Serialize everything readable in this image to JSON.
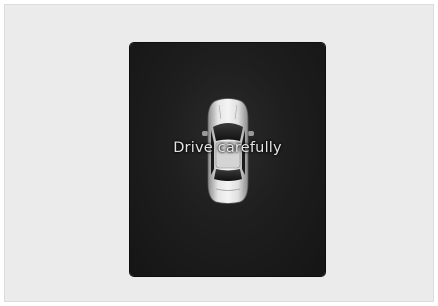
{
  "display": {
    "message": "Drive carefully",
    "icon": "car-top-view-icon",
    "colors": {
      "background": "#ebebeb",
      "screen": "#1e1e1e",
      "text": "#e4e4e4"
    }
  }
}
